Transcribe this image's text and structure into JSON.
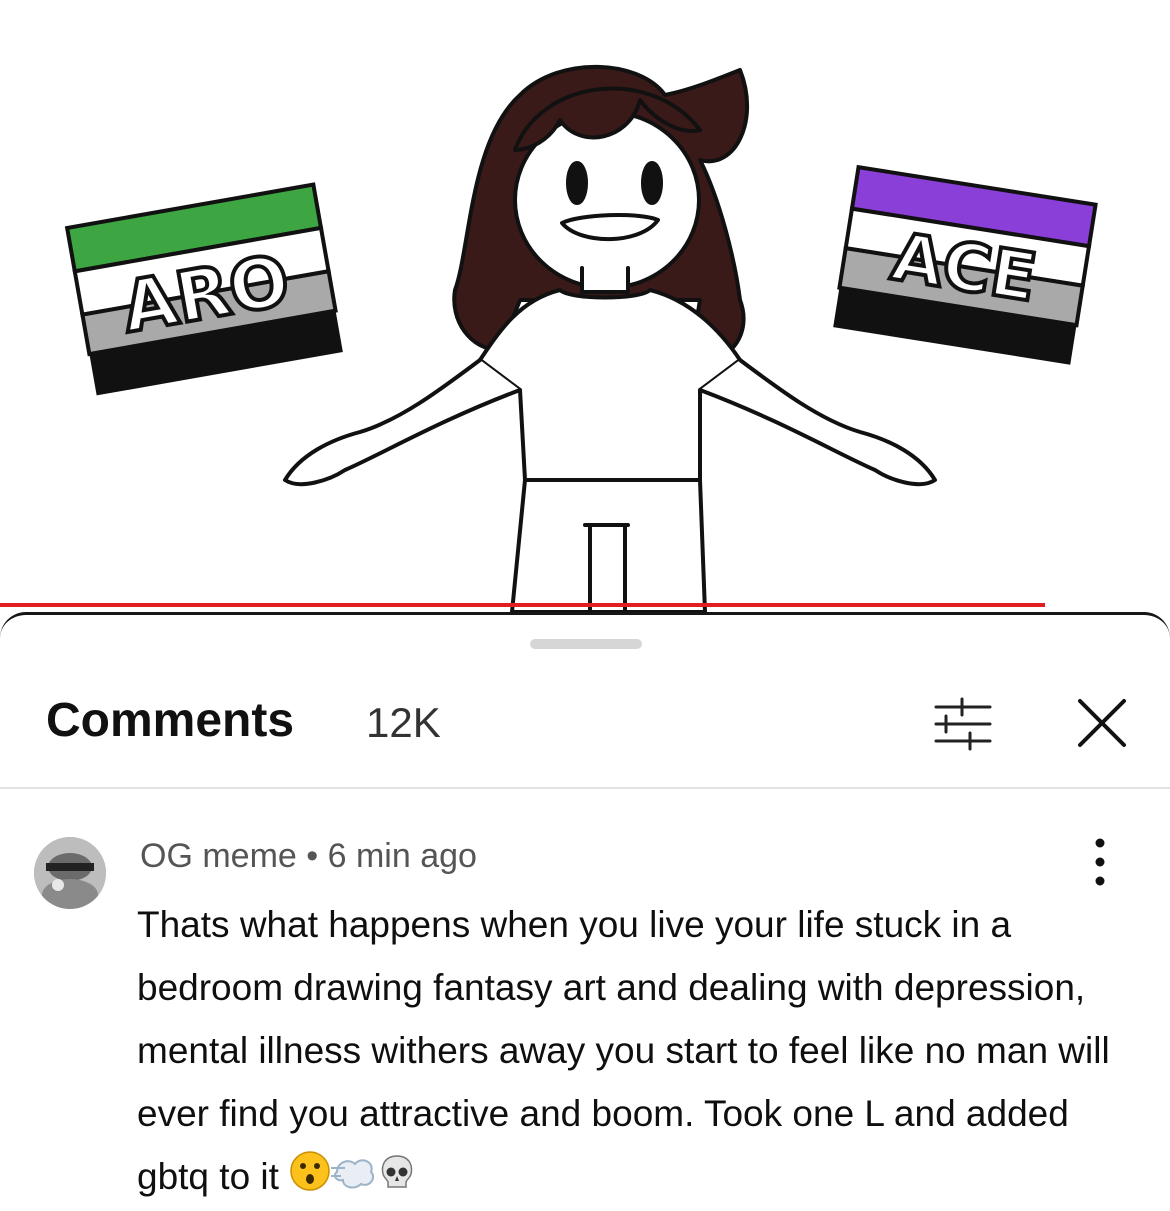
{
  "video": {
    "flag_left_text": "ARO",
    "flag_right_text": "ACE",
    "colors": {
      "aro": [
        "#3da542",
        "#ffffff",
        "#a9a9a9",
        "#111111"
      ],
      "ace": [
        "#8a3fd9",
        "#ffffff",
        "#a9a9a9",
        "#111111"
      ],
      "hair": "#3a1a18",
      "progress": "#e02020"
    }
  },
  "comments_panel": {
    "title": "Comments",
    "count": "12K",
    "filter_icon": "sliders-icon",
    "close_icon": "close-icon"
  },
  "comment": {
    "author": "OG meme",
    "separator": "•",
    "time": "6 min ago",
    "text": "Thats what happens when you live your life stuck in a bedroom drawing fantasy art and dealing with depression, mental illness withers away you start to feel like no man will ever find you attractive and boom. Took one L and added gbtq to it",
    "emojis": [
      "hushed-face-icon",
      "dash-icon",
      "skull-icon"
    ],
    "more_icon": "more-vert-icon"
  }
}
